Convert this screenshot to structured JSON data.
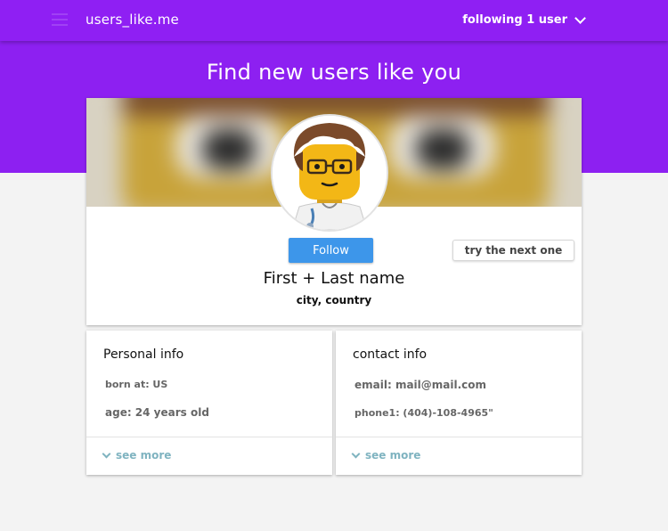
{
  "header": {
    "app_title": "users_like.me",
    "following_label": "following 1 user"
  },
  "page": {
    "title": "Find new users like you"
  },
  "profile": {
    "follow_label": "Follow",
    "next_label": "try the next one",
    "name": "First + Last name",
    "location": "city, country"
  },
  "personal_info": {
    "title": "Personal info",
    "born": "born at: US",
    "age": "age: 24 years old",
    "see_more": "see more"
  },
  "contact_info": {
    "title": "contact info",
    "email": "email: mail@mail.com",
    "phone": "phone1: (404)-108-4965\"",
    "see_more": "see more"
  },
  "colors": {
    "brand_purple": "#8d20f1",
    "follow_blue": "#3d96ea",
    "link_teal": "#7fb3c0"
  },
  "icons": {
    "menu": "hamburger-menu-icon",
    "dropdown": "chevron-down-icon",
    "see_more": "chevron-down-icon"
  }
}
